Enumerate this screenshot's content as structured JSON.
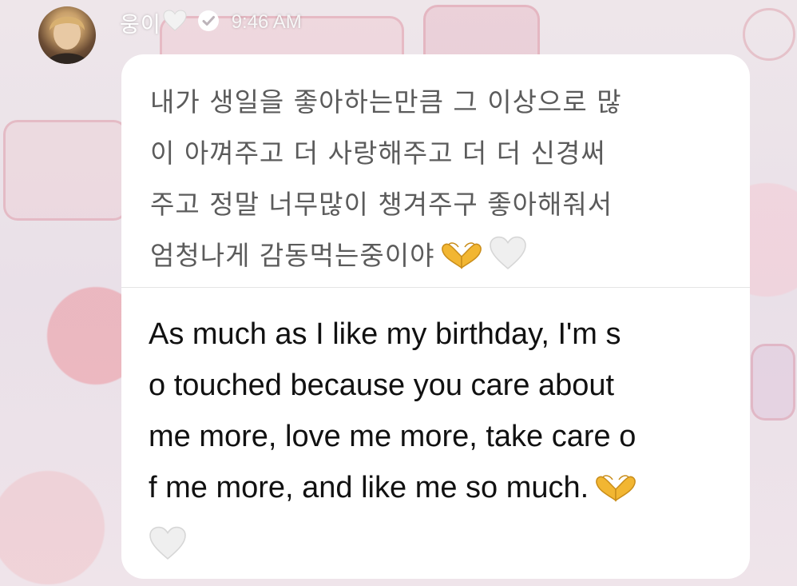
{
  "sender": {
    "name": "웅이",
    "name_emoji": "white-heart-icon",
    "verified": true,
    "verified_icon": "verified-badge-icon"
  },
  "timestamp": "9:46 AM",
  "message": {
    "original_lines": [
      "내가 생일을 좋아하는만큼 그 이상으로 많",
      "이 아껴주고 더 사랑해주고 더 더 신경써",
      "주고 정말 너무많이 챙겨주구 좋아해줘서",
      "엄청나게 감동먹는중이야"
    ],
    "original_trailing_emojis": [
      "heart-hands-icon",
      "white-heart-icon"
    ],
    "translation_lines": [
      "As much as I like my birthday, I'm s",
      "o touched because you care about",
      "me more, love me more, take care o",
      "f me more, and like me so much."
    ],
    "translation_trailing_emojis": [
      "heart-hands-icon",
      "white-heart-icon"
    ]
  },
  "colors": {
    "bubble_background": "#ffffff",
    "original_text": "#5b5b5b",
    "translated_text": "#111111",
    "header_text": "#ffffff",
    "heart_hands": "#f2b632",
    "white_heart": "#e8e8e8"
  }
}
